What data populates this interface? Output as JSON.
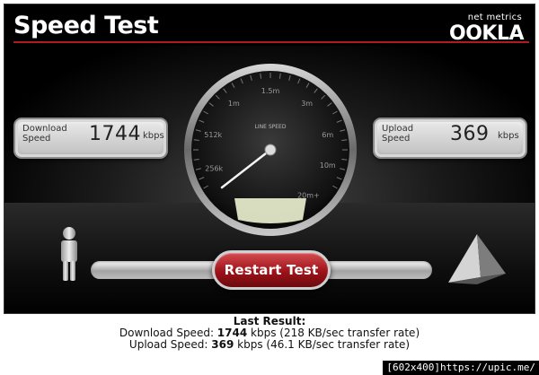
{
  "app": {
    "title": "Speed Test",
    "brand_small": "net metrics",
    "brand_large": "OOKLA"
  },
  "gauge": {
    "center_label": "LINE SPEED",
    "ticks": [
      "512k",
      "1m",
      "1.5m",
      "3m",
      "6m",
      "10m",
      "20m+",
      "256k"
    ],
    "needle_value": "256k"
  },
  "download": {
    "label_line1": "Download",
    "label_line2": "Speed",
    "value": "1744",
    "unit": "kbps"
  },
  "upload": {
    "label_line1": "Upload",
    "label_line2": "Speed",
    "value": "369",
    "unit": "kbps"
  },
  "controls": {
    "restart_label": "Restart Test"
  },
  "progress": {
    "fraction": 1.0
  },
  "results": {
    "heading": "Last Result:",
    "download_prefix": "Download Speed: ",
    "download_value": "1744",
    "download_suffix": " kbps (218 KB/sec transfer rate)",
    "upload_prefix": "Upload Speed: ",
    "upload_value": "369",
    "upload_suffix": " kbps (46.1 KB/sec transfer rate)"
  },
  "watermark": "[602x400]https://upic.me/",
  "colors": {
    "accent_red": "#b01a22",
    "button_red": "#9e1219",
    "gauge_fill": "#e4e8c8"
  }
}
